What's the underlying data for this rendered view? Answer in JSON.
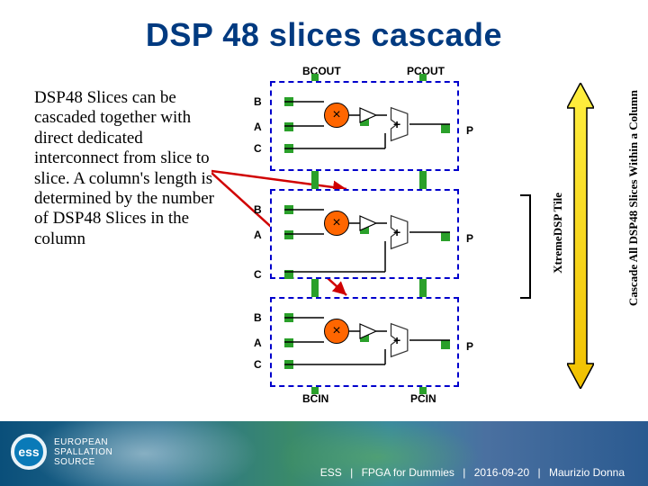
{
  "title": "DSP 48 slices cascade",
  "body_text": "DSP48 Slices can be cascaded together with direct dedicated interconnect from slice to slice. A column's length is determined by the number of DSP48 Slices in the column",
  "diagram": {
    "top_labels": {
      "bcout": "BCOUT",
      "pcout": "PCOUT"
    },
    "bottom_labels": {
      "bcin": "BCIN",
      "pcin": "PCIN"
    },
    "port_B": "B",
    "port_A": "A",
    "port_C": "C",
    "port_P": "P",
    "mult": "×",
    "add": "+",
    "bracket_label": "XtremeDSP Tile",
    "cascade_label": "Cascade All DSP48 Slices Within a Column"
  },
  "footer": {
    "logo_abbrev": "ess",
    "logo_line1": "EUROPEAN",
    "logo_line2": "SPALLATION",
    "logo_line3": "SOURCE",
    "org": "ESS",
    "talk": "FPGA for Dummies",
    "date": "2016-09-20",
    "author": "Maurizio Donna",
    "sep": "|"
  }
}
